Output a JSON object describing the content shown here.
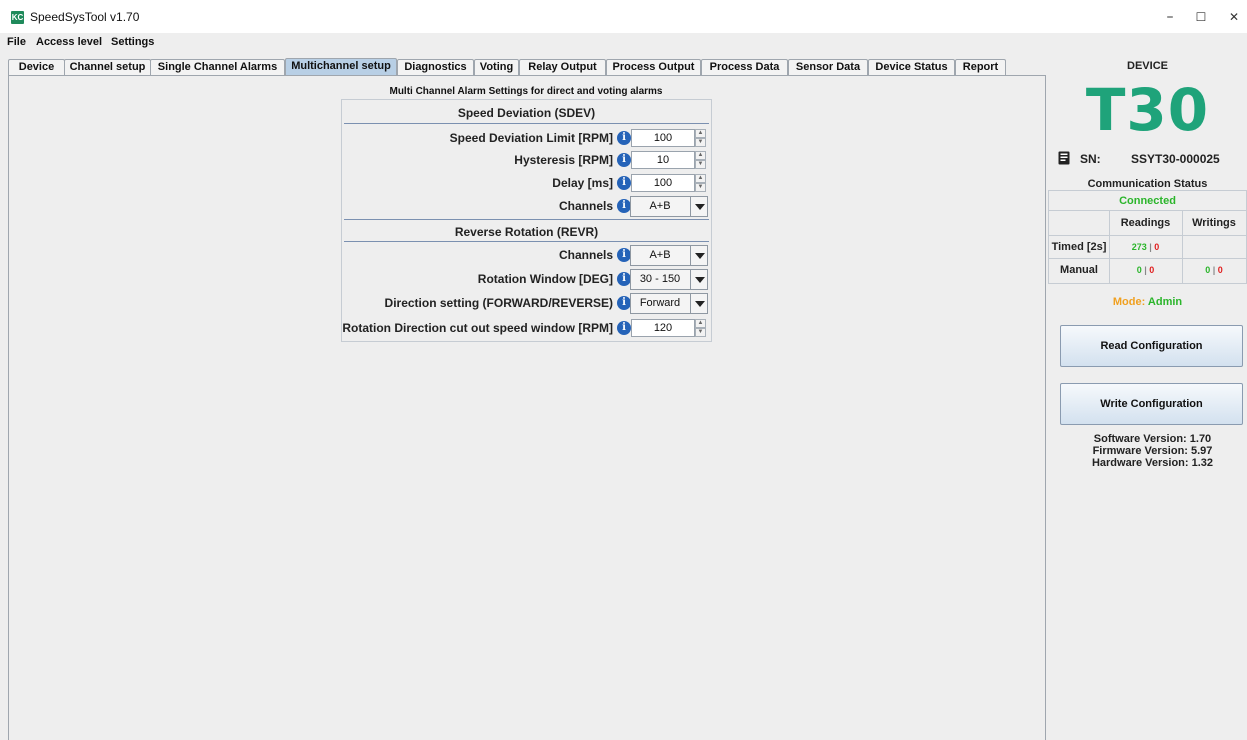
{
  "window": {
    "title": "SpeedSysTool v1.70",
    "icon_text": "KC",
    "controls": [
      "–",
      "☐",
      "✕"
    ]
  },
  "menu": [
    "File",
    "Access level",
    "Settings"
  ],
  "tabs": [
    {
      "label": "Device"
    },
    {
      "label": "Channel setup"
    },
    {
      "label": "Single Channel Alarms"
    },
    {
      "label": "Multichannel setup",
      "active": true
    },
    {
      "label": "Diagnostics"
    },
    {
      "label": "Voting"
    },
    {
      "label": "Relay Output"
    },
    {
      "label": "Process Output"
    },
    {
      "label": "Process Data"
    },
    {
      "label": "Sensor Data"
    },
    {
      "label": "Device Status"
    },
    {
      "label": "Report"
    }
  ],
  "main": {
    "heading": "Multi Channel Alarm Settings for direct and voting alarms",
    "sdev": {
      "title": "Speed Deviation (SDEV)",
      "limit_label": "Speed Deviation Limit [RPM]",
      "limit_value": "100",
      "hysteresis_label": "Hysteresis [RPM]",
      "hysteresis_value": "10",
      "delay_label": "Delay [ms]",
      "delay_value": "100",
      "channels_label": "Channels",
      "channels_value": "A+B"
    },
    "revr": {
      "title": "Reverse Rotation (REVR)",
      "channels_label": "Channels",
      "channels_value": "A+B",
      "window_label": "Rotation Window [DEG]",
      "window_value": "30 - 150",
      "direction_label": "Direction setting (FORWARD/REVERSE)",
      "direction_value": "Forward",
      "cutout_label": "Rotation Direction cut out speed window [RPM]",
      "cutout_value": "120"
    }
  },
  "side": {
    "device_label": "DEVICE",
    "model": "T30",
    "sn_label": "SN:",
    "sn_value": "SSYT30-000025",
    "comm_title": "Communication Status",
    "comm_state": "Connected",
    "headers": {
      "readings": "Readings",
      "writings": "Writings"
    },
    "timed": {
      "label": "Timed [2s]",
      "read_ok": "273",
      "read_err": "0",
      "write_ok": "",
      "write_err": ""
    },
    "manual": {
      "label": "Manual",
      "read_ok": "0",
      "read_err": "0",
      "write_ok": "0",
      "write_err": "0"
    },
    "mode_label": "Mode:",
    "mode_value": "Admin",
    "read_btn": "Read Configuration",
    "write_btn": "Write Configuration",
    "software_version": "Software Version: 1.70",
    "firmware_version": "Firmware Version: 5.97",
    "hardware_version": "Hardware Version: 1.32"
  },
  "colors": {
    "accent": "#1fa37a",
    "ok": "#2bb52b",
    "err": "#e02020",
    "mode": "#f0a020",
    "active_tab": "#b8cfe5",
    "info": "#2563b8"
  }
}
